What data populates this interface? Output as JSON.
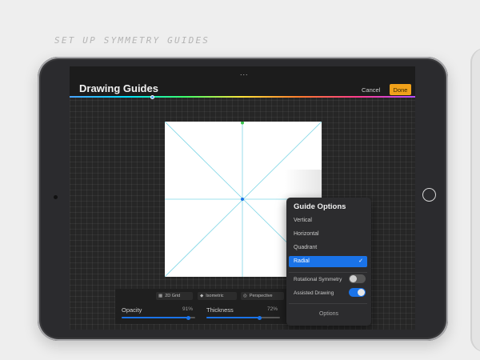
{
  "caption": "SET UP SYMMETRY GUIDES",
  "header": {
    "title": "Drawing Guides",
    "cancel_label": "Cancel",
    "done_label": "Done",
    "more_icon": "..."
  },
  "color_slider": {
    "position": 0.24
  },
  "guide_options": {
    "title": "Guide Options",
    "items": [
      {
        "label": "Vertical"
      },
      {
        "label": "Horizontal"
      },
      {
        "label": "Quadrant"
      },
      {
        "label": "Radial",
        "selected": true
      }
    ],
    "check_icon": "✓",
    "rotational_symmetry": {
      "label": "Rotational Symmetry",
      "on": false
    },
    "assisted_drawing": {
      "label": "Assisted Drawing",
      "on": true
    },
    "options_label": "Options"
  },
  "guide_modes": {
    "tabs": [
      {
        "label": "2D Grid",
        "icon": "grid-icon"
      },
      {
        "label": "Isometric",
        "icon": "isometric-icon"
      },
      {
        "label": "Perspective",
        "icon": "perspective-icon"
      }
    ]
  },
  "sliders": {
    "opacity": {
      "label": "Opacity",
      "value_text": "91%",
      "value": 0.91
    },
    "thickness": {
      "label": "Thickness",
      "value_text": "72%",
      "value": 0.72
    }
  },
  "colors": {
    "accent": "#1a73e8",
    "done": "#f0a11a",
    "guide_line": "#7fd6e6"
  }
}
